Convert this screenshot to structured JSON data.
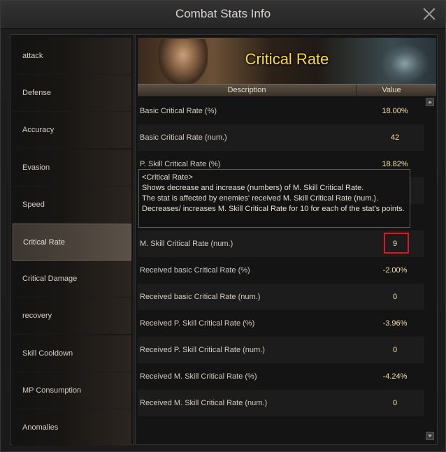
{
  "window": {
    "title": "Combat Stats Info"
  },
  "sidebar": {
    "items": [
      {
        "label": "attack"
      },
      {
        "label": "Defense"
      },
      {
        "label": "Accuracy"
      },
      {
        "label": "Evasion"
      },
      {
        "label": "Speed"
      },
      {
        "label": "Critical Rate",
        "active": true
      },
      {
        "label": "Critical Damage"
      },
      {
        "label": "recovery"
      },
      {
        "label": "Skill Cooldown"
      },
      {
        "label": "MP Consumption"
      },
      {
        "label": "Anomalies"
      }
    ]
  },
  "content": {
    "banner_title": "Critical Rate",
    "columns": {
      "description": "Description",
      "value": "Value"
    },
    "rows": [
      {
        "label": "Basic Critical Rate (%)",
        "value": "18.00%"
      },
      {
        "label": "Basic Critical Rate (num.)",
        "value": "42"
      },
      {
        "label": "P. Skill Critical Rate (%)",
        "value": "18.82%"
      },
      {
        "label": "",
        "value": ""
      },
      {
        "label": "",
        "value": ""
      },
      {
        "label": "M. Skill Critical Rate (num.)",
        "value": "9"
      },
      {
        "label": "Received basic Critical Rate (%)",
        "value": "-2.00%"
      },
      {
        "label": "Received basic Critical Rate (num.)",
        "value": "0"
      },
      {
        "label": "Received P. Skill Critical Rate (%)",
        "value": "-3.96%"
      },
      {
        "label": "Received P. Skill Critical Rate (num.)",
        "value": "0"
      },
      {
        "label": "Received M. Skill Critical Rate (%)",
        "value": "-4.24%"
      },
      {
        "label": "Received M. Skill Critical Rate (num.)",
        "value": "0"
      }
    ]
  },
  "tooltip": {
    "title": "<Critical Rate>",
    "line1": "Shows decrease and increase (numbers) of M. Skill Critical Rate.",
    "line2": "The stat is affected by enemies' received M. Skill Critical Rate (num.).",
    "line3": "Decreases/ increases M. Skill Critical Rate for 10 for each of the stat's points."
  },
  "colors": {
    "title_gold": "#ffde2a",
    "highlight_red": "#e0161c"
  }
}
